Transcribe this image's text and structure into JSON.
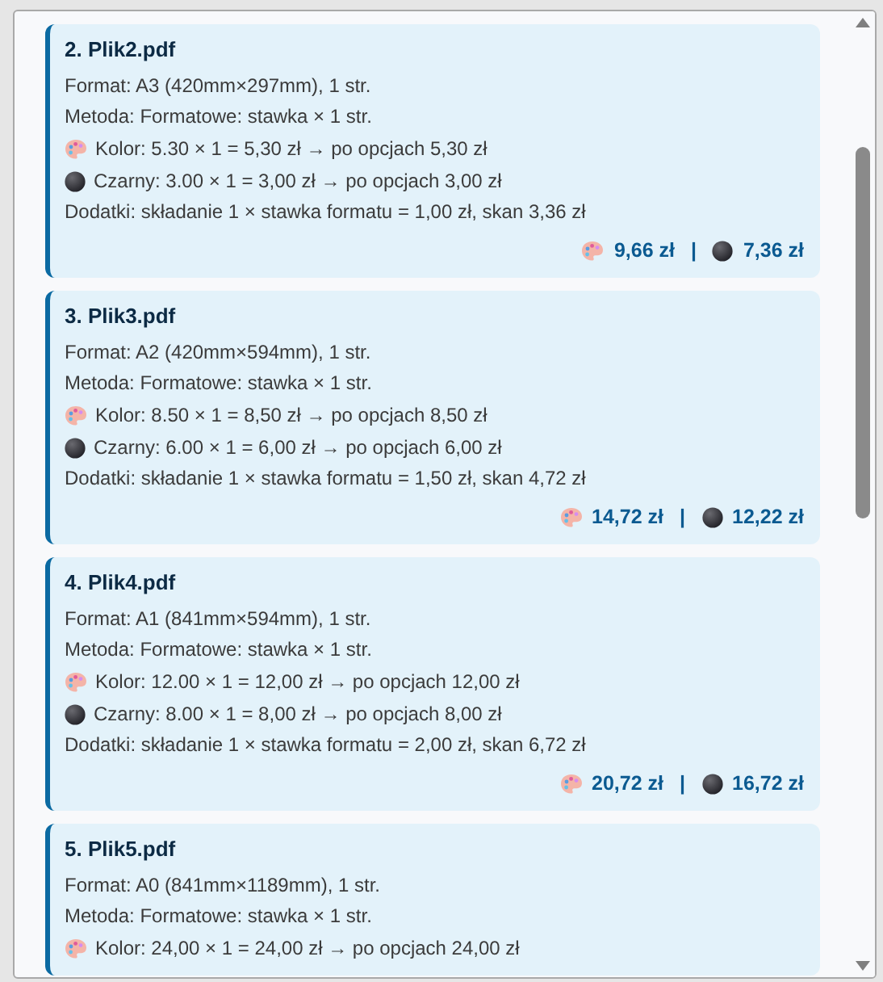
{
  "files": [
    {
      "title": "2. Plik2.pdf",
      "lines": [
        {
          "kind": "text",
          "text": "Format: A3 (420mm×297mm), 1 str."
        },
        {
          "kind": "text",
          "text": "Metoda: Formatowe: stawka × 1 str."
        },
        {
          "kind": "color",
          "text": "Kolor: 5.30 × 1 = 5,30 zł → po opcjach 5,30 zł"
        },
        {
          "kind": "black",
          "text": "Czarny: 3.00 × 1 = 3,00 zł → po opcjach 3,00 zł"
        },
        {
          "kind": "text",
          "text": "Dodatki: składanie 1 × stawka formatu = 1,00 zł, skan 3,36 zł"
        }
      ],
      "totals": {
        "kolor_total": "9,66 zł",
        "separator": "|",
        "czarny_total": "7,36 zł"
      }
    },
    {
      "title": "3. Plik3.pdf",
      "lines": [
        {
          "kind": "text",
          "text": "Format: A2 (420mm×594mm), 1 str."
        },
        {
          "kind": "text",
          "text": "Metoda: Formatowe: stawka × 1 str."
        },
        {
          "kind": "color",
          "text": "Kolor: 8.50 × 1 = 8,50 zł → po opcjach 8,50 zł"
        },
        {
          "kind": "black",
          "text": "Czarny: 6.00 × 1 = 6,00 zł → po opcjach 6,00 zł"
        },
        {
          "kind": "text",
          "text": "Dodatki: składanie 1 × stawka formatu = 1,50 zł, skan 4,72 zł"
        }
      ],
      "totals": {
        "kolor_total": "14,72 zł",
        "separator": "|",
        "czarny_total": "12,22 zł"
      }
    },
    {
      "title": "4. Plik4.pdf",
      "lines": [
        {
          "kind": "text",
          "text": "Format: A1 (841mm×594mm), 1 str."
        },
        {
          "kind": "text",
          "text": "Metoda: Formatowe: stawka × 1 str."
        },
        {
          "kind": "color",
          "text": "Kolor: 12.00 × 1 = 12,00 zł → po opcjach 12,00 zł"
        },
        {
          "kind": "black",
          "text": "Czarny: 8.00 × 1 = 8,00 zł → po opcjach 8,00 zł"
        },
        {
          "kind": "text",
          "text": "Dodatki: składanie 1 × stawka formatu = 2,00 zł, skan 6,72 zł"
        }
      ],
      "totals": {
        "kolor_total": "20,72 zł",
        "separator": "|",
        "czarny_total": "16,72 zł"
      }
    },
    {
      "title": "5. Plik5.pdf",
      "lines": [
        {
          "kind": "text",
          "text": "Format: A0 (841mm×1189mm), 1 str."
        },
        {
          "kind": "text",
          "text": "Metoda: Formatowe: stawka × 1 str."
        },
        {
          "kind": "color",
          "text": "Kolor: 24,00 × 1 = 24,00 zł → po opcjach 24,00 zł"
        }
      ]
    }
  ]
}
